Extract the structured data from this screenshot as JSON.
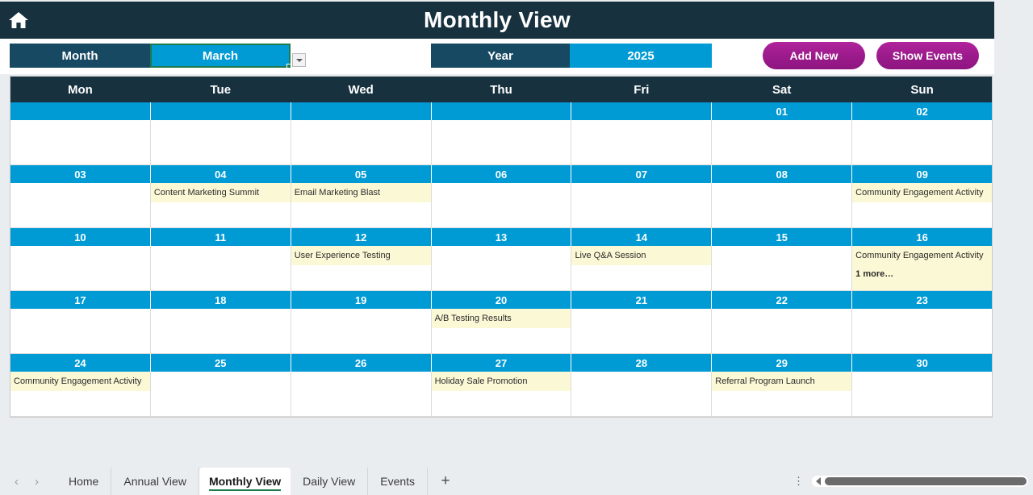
{
  "header": {
    "title": "Monthly View",
    "home_icon": "home-icon"
  },
  "controls": {
    "month_label": "Month",
    "month_value": "March",
    "year_label": "Year",
    "year_value": "2025",
    "add_new_label": "Add New",
    "show_events_label": "Show Events",
    "dropdown_icon": "chevron-down-icon"
  },
  "calendar": {
    "day_headers": [
      "Mon",
      "Tue",
      "Wed",
      "Thu",
      "Fri",
      "Sat",
      "Sun"
    ],
    "weeks": [
      {
        "dates": [
          "",
          "",
          "",
          "",
          "",
          "01",
          "02"
        ],
        "events": [
          [],
          [],
          [],
          [],
          [],
          [],
          []
        ],
        "more": [
          "",
          "",
          "",
          "",
          "",
          "",
          ""
        ]
      },
      {
        "dates": [
          "03",
          "04",
          "05",
          "06",
          "07",
          "08",
          "09"
        ],
        "events": [
          [],
          [
            "Content Marketing Summit"
          ],
          [
            "Email Marketing Blast"
          ],
          [],
          [],
          [],
          [
            "Community Engagement Activity"
          ]
        ],
        "more": [
          "",
          "",
          "",
          "",
          "",
          "",
          ""
        ]
      },
      {
        "dates": [
          "10",
          "11",
          "12",
          "13",
          "14",
          "15",
          "16"
        ],
        "events": [
          [],
          [],
          [
            "User Experience Testing"
          ],
          [],
          [
            "Live Q&A Session"
          ],
          [],
          [
            "Community Engagement Activity"
          ]
        ],
        "more": [
          "",
          "",
          "",
          "",
          "",
          "",
          "1 more…"
        ]
      },
      {
        "dates": [
          "17",
          "18",
          "19",
          "20",
          "21",
          "22",
          "23"
        ],
        "events": [
          [],
          [],
          [],
          [
            "A/B Testing Results"
          ],
          [],
          [],
          []
        ],
        "more": [
          "",
          "",
          "",
          "",
          "",
          "",
          ""
        ]
      },
      {
        "dates": [
          "24",
          "25",
          "26",
          "27",
          "28",
          "29",
          "30"
        ],
        "events": [
          [
            "Community Engagement Activity"
          ],
          [],
          [],
          [
            "Holiday Sale Promotion"
          ],
          [],
          [
            "Referral Program Launch"
          ],
          []
        ],
        "more": [
          "",
          "",
          "",
          "",
          "",
          "",
          ""
        ]
      }
    ]
  },
  "sheetbar": {
    "prev_label": "‹",
    "next_label": "›",
    "tabs": [
      {
        "label": "Home",
        "active": false
      },
      {
        "label": "Annual View",
        "active": false
      },
      {
        "label": "Monthly View",
        "active": true
      },
      {
        "label": "Daily View",
        "active": false
      },
      {
        "label": "Events",
        "active": false
      }
    ],
    "add_sheet_label": "+",
    "kebab_label": "⋮"
  },
  "colors": {
    "navy": "#17313f",
    "steel": "#174963",
    "azure": "#009ad4",
    "magenta": "#9c1b8c",
    "event_yellow": "#fbf8d5",
    "selection_green": "#1f7a4d"
  }
}
